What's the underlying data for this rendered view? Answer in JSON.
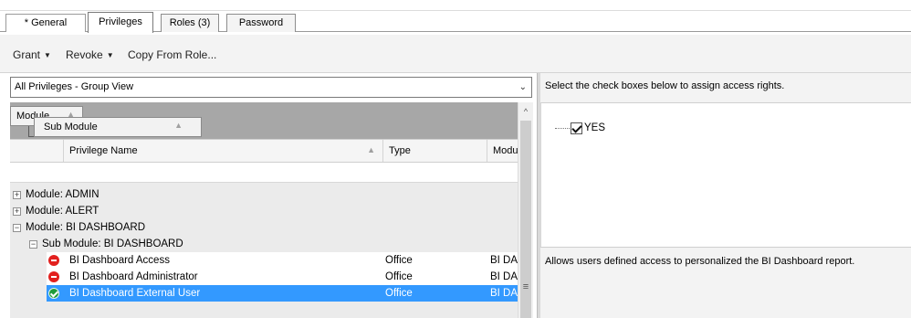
{
  "tabs": [
    {
      "label": "* General"
    },
    {
      "label": "Privileges"
    },
    {
      "label": "Roles (3)"
    },
    {
      "label": "Password"
    }
  ],
  "toolbar": {
    "grant_label": "Grant",
    "revoke_label": "Revoke",
    "copy_from_role_label": "Copy From Role..."
  },
  "view_select": {
    "value": "All Privileges - Group View"
  },
  "group_by": {
    "chips": [
      "Module",
      "Sub Module"
    ]
  },
  "grid": {
    "columns": [
      "Privilege Name",
      "Type",
      "Modu"
    ],
    "group_rows": [
      {
        "label": "Module:  ADMIN",
        "expanded": false
      },
      {
        "label": "Module:  ALERT",
        "expanded": false
      },
      {
        "label": "Module:  BI DASHBOARD",
        "expanded": true
      }
    ],
    "sub_group": {
      "label": "Sub Module:  BI DASHBOARD",
      "expanded": true
    },
    "rows": [
      {
        "name": "BI Dashboard Access",
        "type": "Office",
        "module": "BI DA",
        "status": "denied",
        "icon": "deny-icon"
      },
      {
        "name": "BI Dashboard Administrator",
        "type": "Office",
        "module": "BI DA",
        "status": "denied",
        "icon": "deny-icon"
      },
      {
        "name": "BI Dashboard External User",
        "type": "Office",
        "module": "BI DA",
        "status": "granted",
        "icon": "allow-icon",
        "selected": true
      }
    ]
  },
  "rights_panel": {
    "instruction": "Select the check boxes below to assign access rights.",
    "option_label": "YES",
    "option_checked": true,
    "description": "Allows users defined access to personalized the BI Dashboard report."
  },
  "colors": {
    "selection": "#3399ff",
    "deny": "#e2201e",
    "allow": "#1f9d3a"
  }
}
